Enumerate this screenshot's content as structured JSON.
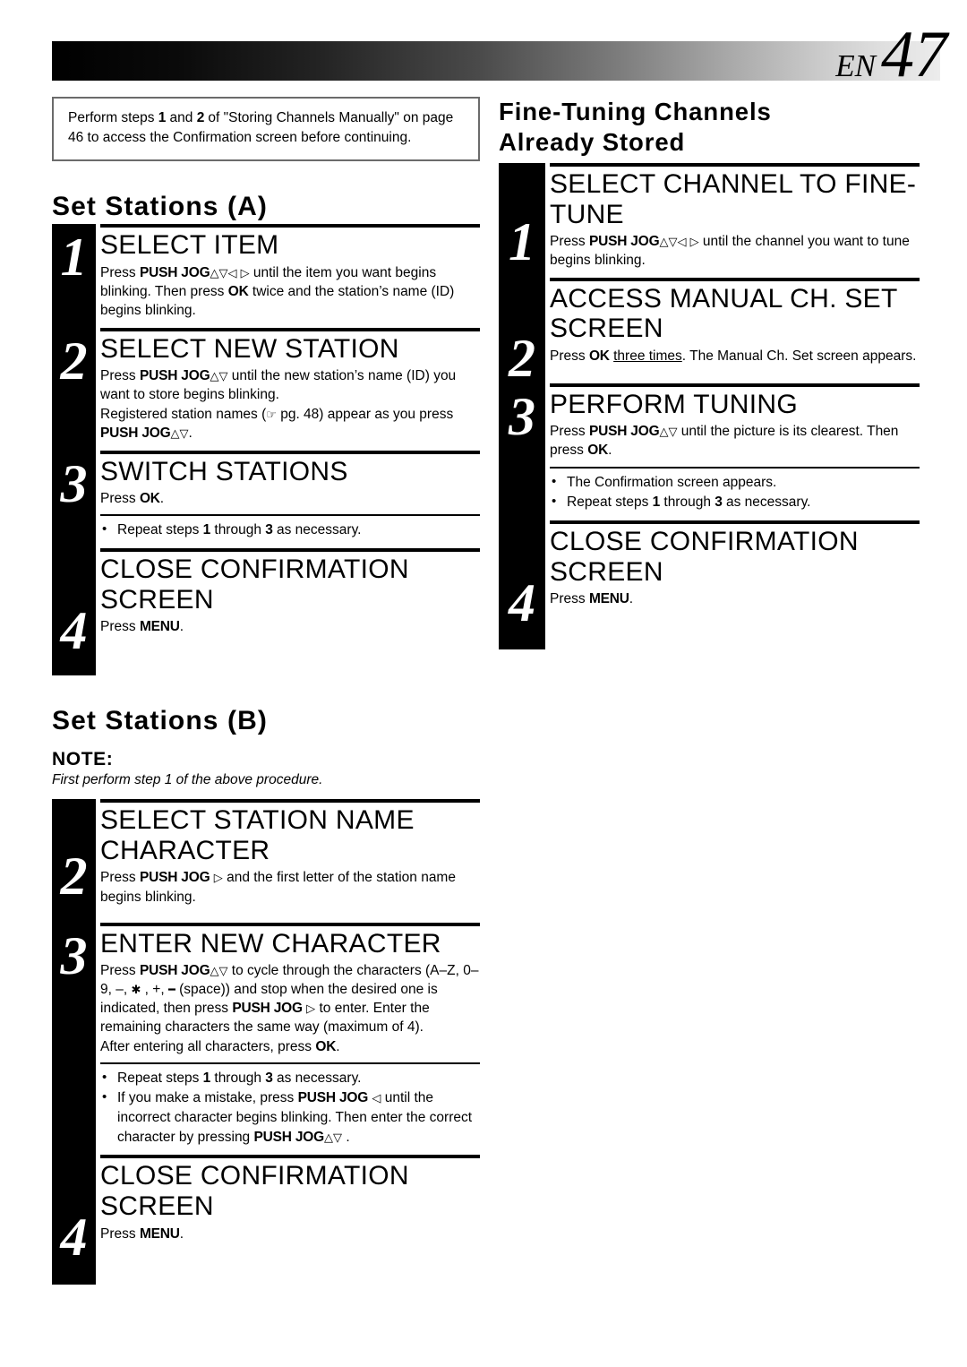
{
  "header": {
    "lang_code": "EN",
    "page_number": "47"
  },
  "left_column": {
    "notice_box": {
      "text": "Perform steps 1 and 2 of \"Storing Channels Manually\" on page 46 to access the Confirmation screen before continuing."
    },
    "section_a": {
      "title": "Set Stations (A)",
      "steps": [
        {
          "number": "1",
          "heading": "SELECT ITEM",
          "body": "Press PUSH JOG△▽◁▷ until the item you want begins blinking. Then press OK twice and the station's name (ID) begins blinking."
        },
        {
          "number": "2",
          "heading": "SELECT NEW STATION",
          "body": "Press PUSH JOG△▽ until the new station's name (ID) you want to store begins blinking.\nRegistered station names (☞ pg. 48) appear as you press PUSH JOG△▽."
        },
        {
          "number": "3",
          "heading": "SWITCH STATIONS",
          "body": "Press OK.",
          "bullets": [
            "Repeat steps 1 through 3 as necessary."
          ]
        },
        {
          "number": "4",
          "heading": "CLOSE CONFIRMATION SCREEN",
          "body": "Press MENU."
        }
      ]
    },
    "section_b": {
      "title": "Set Stations (B)",
      "note_label": "NOTE:",
      "note_text": "First perform step 1 of the above procedure.",
      "steps": [
        {
          "number": "2",
          "heading": "SELECT STATION NAME CHARACTER",
          "body": "Press PUSH JOG ▷ and the first letter of the station name begins blinking."
        },
        {
          "number": "3",
          "heading": "ENTER NEW CHARACTER",
          "body": "Press PUSH JOG△▽ to cycle through the characters (A–Z, 0–9, –, ★, +, ▬ (space)) and stop when the desired one is indicated, then press PUSH JOG ▷ to enter. Enter the remaining characters the same way (maximum of 4).\nAfter entering all characters, press OK.",
          "bullets": [
            "Repeat steps 1 through 3 as necessary.",
            "If you make a mistake, press PUSH JOG ◁ until the incorrect character begins blinking. Then enter the correct character by pressing PUSH JOG△▽."
          ]
        },
        {
          "number": "4",
          "heading": "CLOSE CONFIRMATION SCREEN",
          "body": "Press MENU."
        }
      ]
    }
  },
  "right_column": {
    "title": "Fine-Tuning Channels Already Stored",
    "title_line1": "Fine-Tuning Channels",
    "title_line2": "Already Stored",
    "steps": [
      {
        "number": "1",
        "heading": "SELECT CHANNEL TO FINE-TUNE",
        "body": "Press PUSH JOG△▽◁▷ until the channel you want to tune begins blinking."
      },
      {
        "number": "2",
        "heading": "ACCESS MANUAL CH. SET SCREEN",
        "body": "Press OK three times. The Manual Ch. Set screen appears."
      },
      {
        "number": "3",
        "heading": "PERFORM TUNING",
        "body": "Press PUSH JOG△▽ until the picture is its clearest. Then press OK.",
        "bullets": [
          "The Confirmation screen appears.",
          "Repeat steps 1 through 3 as necessary."
        ]
      },
      {
        "number": "4",
        "heading": "CLOSE CONFIRMATION SCREEN",
        "body": "Press MENU."
      }
    ]
  }
}
